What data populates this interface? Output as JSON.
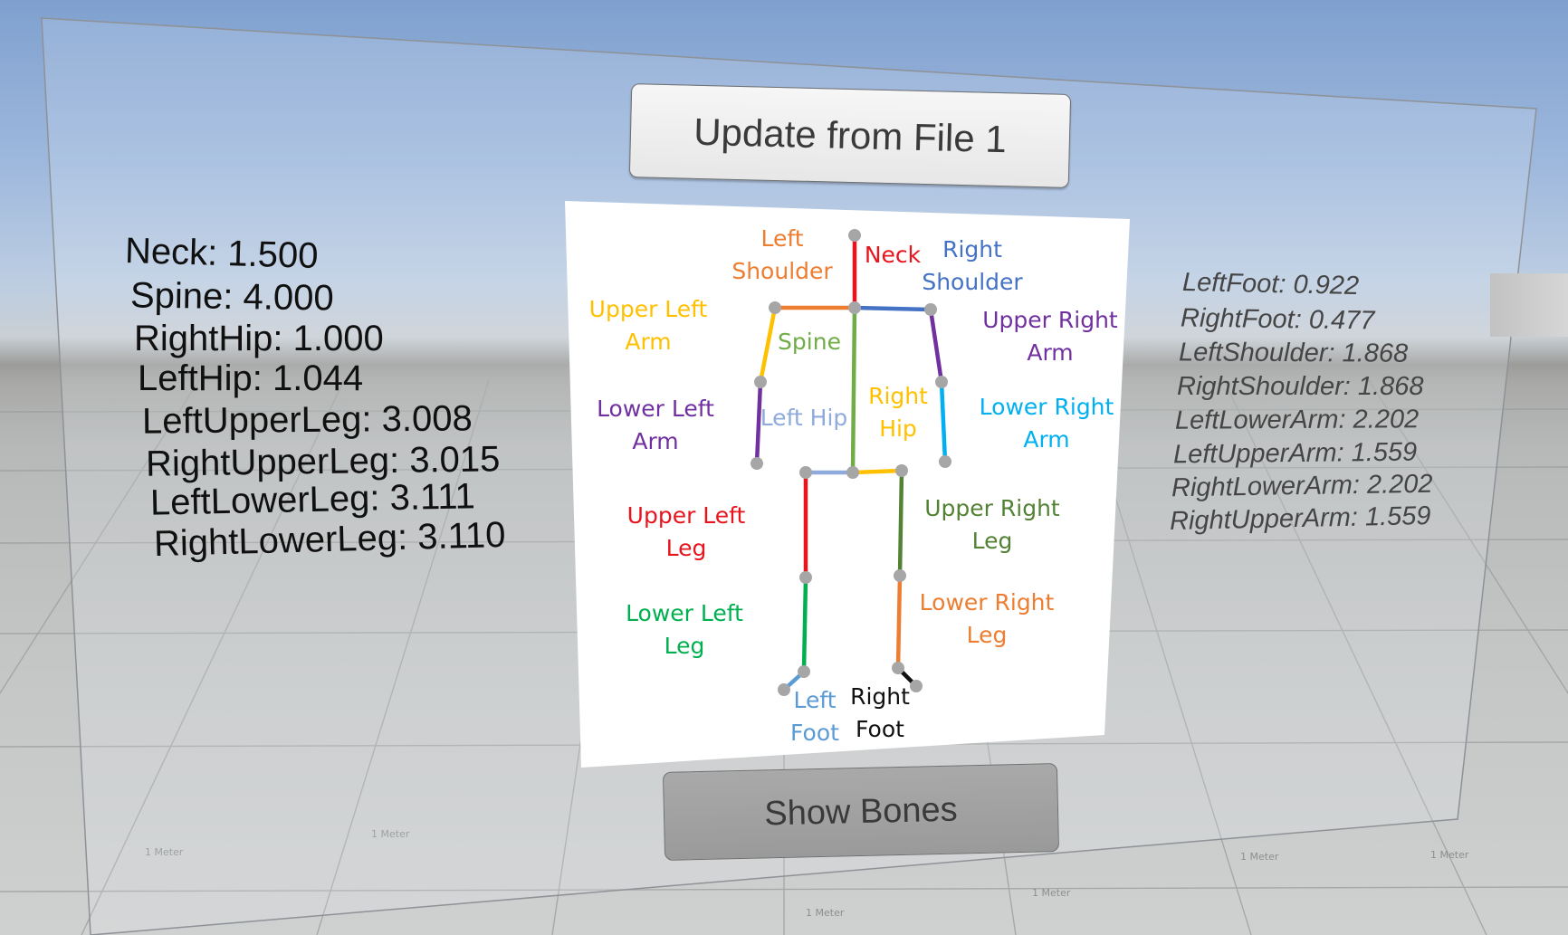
{
  "buttons": {
    "update": "Update from File 1",
    "show_bones": "Show Bones"
  },
  "stats_left": [
    "Neck: 1.500",
    "Spine: 4.000",
    "RightHip: 1.000",
    "LeftHip: 1.044",
    "LeftUpperLeg: 3.008",
    "RightUpperLeg: 3.015",
    "LeftLowerLeg: 3.111",
    "RightLowerLeg: 3.110"
  ],
  "stats_right": [
    "LeftFoot: 0.922",
    "RightFoot: 0.477",
    "LeftShoulder: 1.868",
    "RightShoulder: 1.868",
    "LeftLowerArm: 2.202",
    "LeftUpperArm: 1.559",
    "RightLowerArm: 2.202",
    "RightUpperArm: 1.559"
  ],
  "diagram_labels": {
    "left_shoulder": [
      "Left",
      "Shoulder"
    ],
    "neck": [
      "Neck"
    ],
    "right_shoulder": [
      "Right",
      "Shoulder"
    ],
    "upper_left_arm": [
      "Upper Left",
      "Arm"
    ],
    "spine": [
      "Spine"
    ],
    "upper_right_arm": [
      "Upper Right",
      "Arm"
    ],
    "lower_left_arm": [
      "Lower Left",
      "Arm"
    ],
    "left_hip": [
      "Left Hip"
    ],
    "right_hip": [
      "Right",
      "Hip"
    ],
    "lower_right_arm": [
      "Lower Right",
      "Arm"
    ],
    "upper_left_leg": [
      "Upper Left",
      "Leg"
    ],
    "upper_right_leg": [
      "Upper Right",
      "Leg"
    ],
    "lower_left_leg": [
      "Lower Left",
      "Leg"
    ],
    "lower_right_leg": [
      "Lower Right",
      "Leg"
    ],
    "left_foot": [
      "Left",
      "Foot"
    ],
    "right_foot": [
      "Right",
      "Foot"
    ]
  },
  "bone_colors": {
    "neck": "#e8141e",
    "left_shoulder": "#ed7d31",
    "right_shoulder": "#4472c4",
    "upper_left_arm": "#ffc000",
    "upper_right_arm": "#7030a0",
    "lower_left_arm": "#7030a0",
    "lower_right_arm": "#00b0f0",
    "spine": "#70ad47",
    "left_hip": "#8faadc",
    "right_hip": "#ffc000",
    "upper_left_leg": "#e8141e",
    "upper_right_leg": "#548235",
    "lower_left_leg": "#00b050",
    "lower_right_leg": "#ed7d31",
    "left_foot": "#5b9bd5",
    "right_foot": "#111111",
    "joint": "#a6a6a6"
  },
  "grid_label": "1 Meter"
}
